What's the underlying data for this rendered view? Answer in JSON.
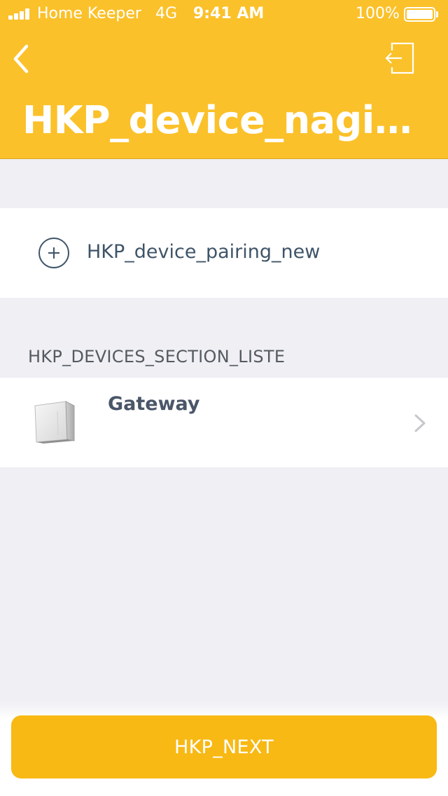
{
  "status_bar": {
    "carrier": "Home Keeper",
    "network": "4G",
    "time": "9:41 AM",
    "battery": "100%"
  },
  "header": {
    "title": "HKP_device_nagiva...",
    "back_icon": "chevron-left-icon",
    "logout_icon": "logout-icon",
    "background_color": "#fbc12a"
  },
  "pairing": {
    "label": "HKP_device_pairing_new",
    "icon": "plus-circle-icon"
  },
  "devices_section": {
    "header": "HKP_DEVICES_SECTION_LISTE",
    "items": [
      {
        "name": "Gateway",
        "icon": "gateway-device-image"
      }
    ]
  },
  "footer": {
    "next_label": "HKP_NEXT",
    "button_color": "#f8b915"
  }
}
